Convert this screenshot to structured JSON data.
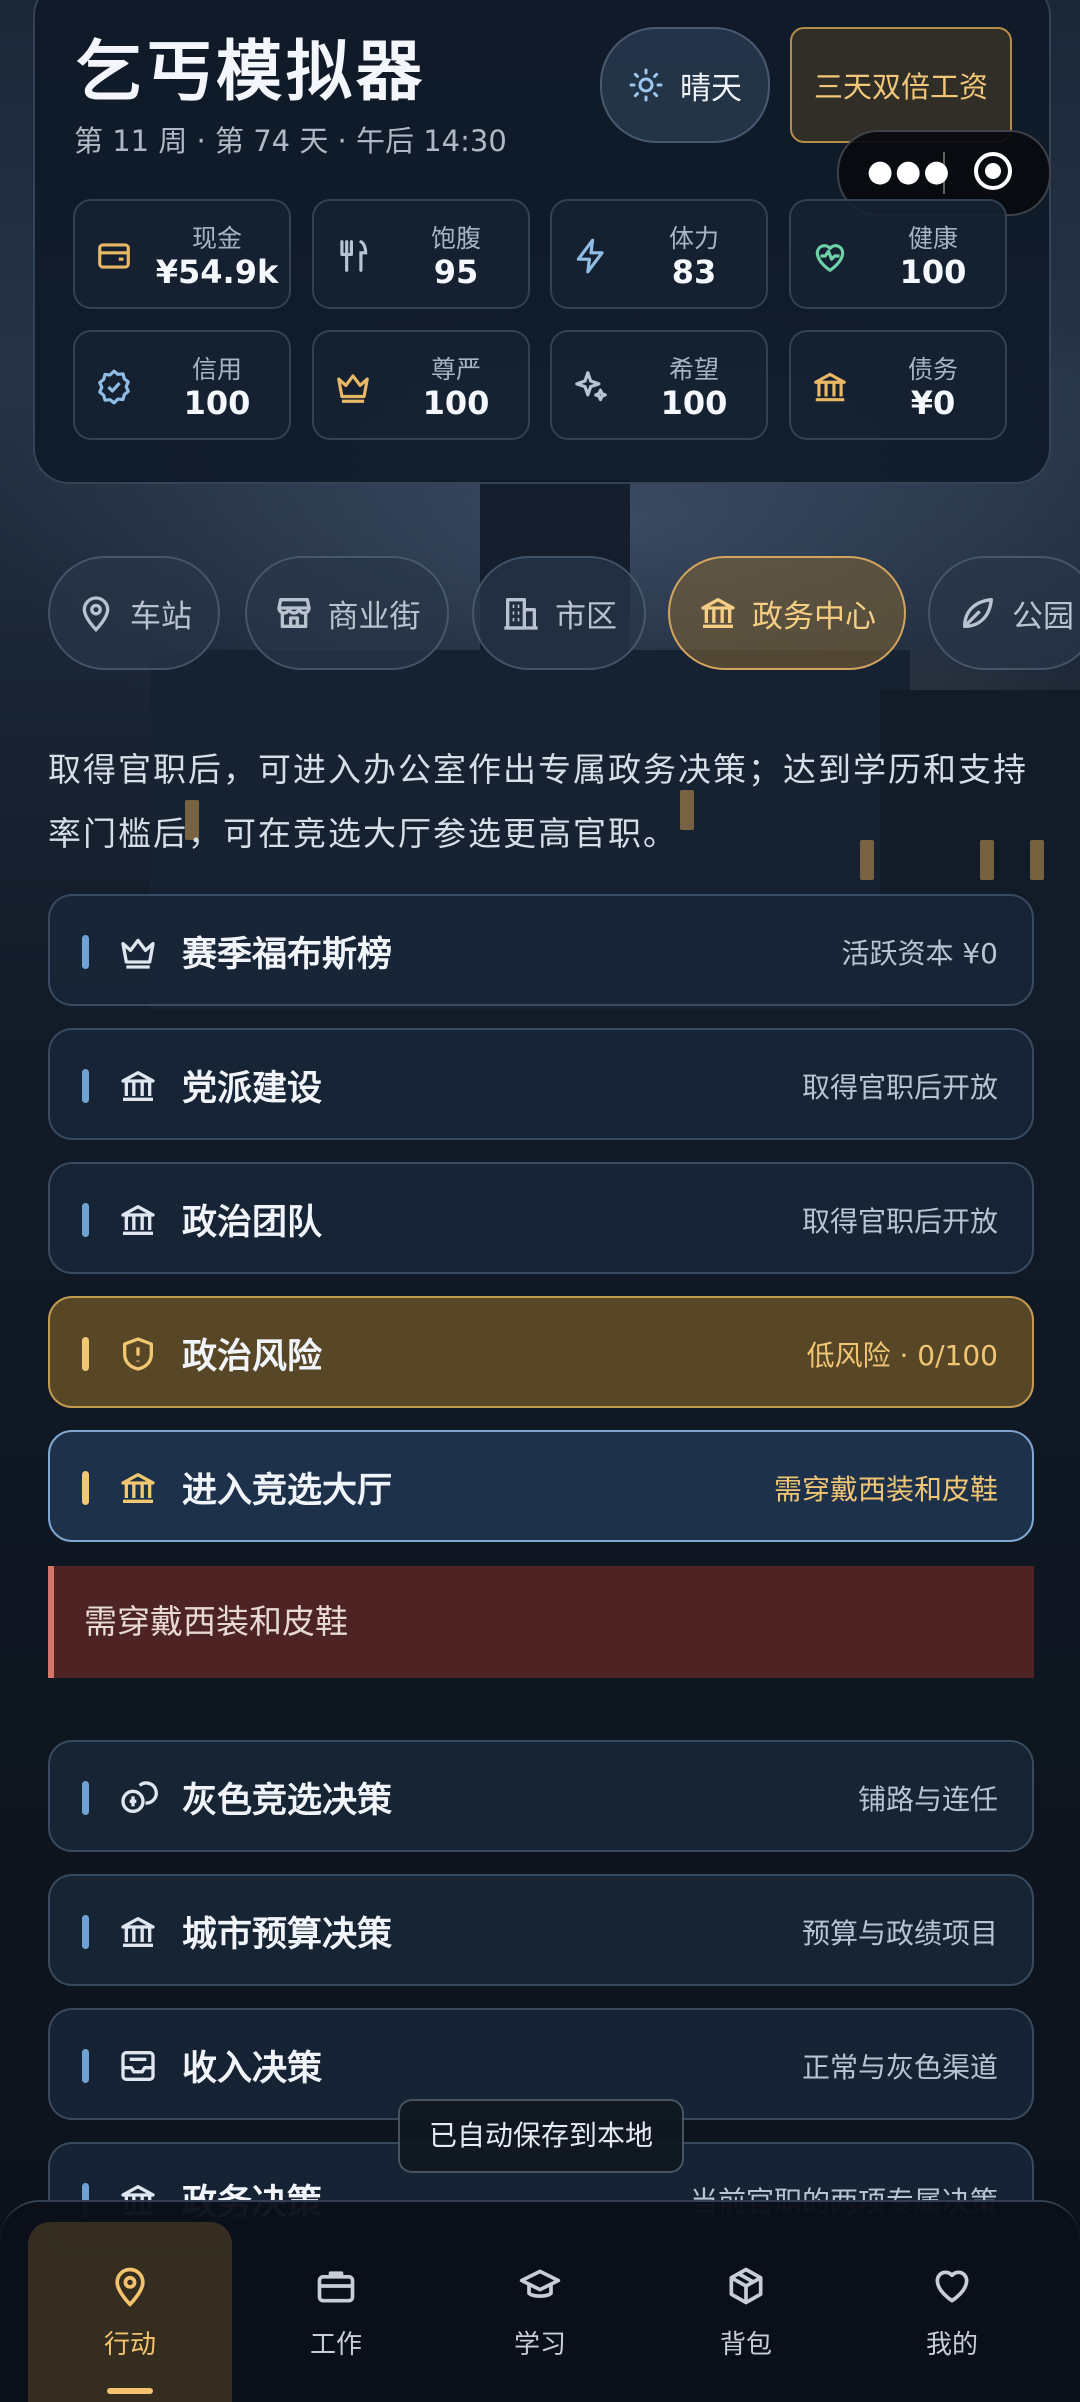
{
  "app": {
    "title": "乞丐模拟器",
    "subtitle": "第 11 周 · 第 74 天 · 午后 14:30",
    "weather": "晴天",
    "promo": "三天双倍工资"
  },
  "stats": [
    {
      "label": "现金",
      "value": "¥54.9k",
      "icon": "wallet-icon"
    },
    {
      "label": "饱腹",
      "value": "95",
      "icon": "utensils-icon"
    },
    {
      "label": "体力",
      "value": "83",
      "icon": "lightning-icon"
    },
    {
      "label": "健康",
      "value": "100",
      "icon": "heart-pulse-icon"
    },
    {
      "label": "信用",
      "value": "100",
      "icon": "badge-check-icon"
    },
    {
      "label": "尊严",
      "value": "100",
      "icon": "crown-icon"
    },
    {
      "label": "希望",
      "value": "100",
      "icon": "sparkle-icon"
    },
    {
      "label": "债务",
      "value": "¥0",
      "icon": "bank-icon"
    }
  ],
  "locations": [
    {
      "label": "车站",
      "icon": "pin-icon",
      "active": false
    },
    {
      "label": "商业街",
      "icon": "store-icon",
      "active": false
    },
    {
      "label": "市区",
      "icon": "buildings-icon",
      "active": false
    },
    {
      "label": "政务中心",
      "icon": "government-icon",
      "active": true
    },
    {
      "label": "公园",
      "icon": "leaf-icon",
      "active": false
    }
  ],
  "description": "取得官职后，可进入办公室作出专属政务决策；达到学历和支持率门槛后，可在竞选大厅参选更高官职。",
  "actions": [
    {
      "title": "赛季福布斯榜",
      "status": "活跃资本  ¥0",
      "icon": "crown-icon"
    },
    {
      "title": "党派建设",
      "status": "取得官职后开放",
      "icon": "government-icon"
    },
    {
      "title": "政治团队",
      "status": "取得官职后开放",
      "icon": "government-icon"
    },
    {
      "title": "政治风险",
      "status": "低风险  ·  0/100",
      "icon": "shield-alert-icon"
    },
    {
      "title": "进入竞选大厅",
      "status": "需穿戴西装和皮鞋",
      "icon": "government-icon"
    }
  ],
  "alert": "需穿戴西装和皮鞋",
  "decisions": [
    {
      "title": "灰色竞选决策",
      "status": "铺路与连任",
      "icon": "coins-icon"
    },
    {
      "title": "城市预算决策",
      "status": "预算与政绩项目",
      "icon": "government-icon"
    },
    {
      "title": "收入决策",
      "status": "正常与灰色渠道",
      "icon": "inbox-icon"
    },
    {
      "title": "政务决策",
      "status": "当前官职的两项专属决策",
      "icon": "government-icon"
    }
  ],
  "toast": "已自动保存到本地",
  "nav": [
    {
      "label": "行动",
      "icon": "map-pin-icon",
      "active": true
    },
    {
      "label": "工作",
      "icon": "briefcase-icon",
      "active": false
    },
    {
      "label": "学习",
      "icon": "graduation-cap-icon",
      "active": false
    },
    {
      "label": "背包",
      "icon": "package-icon",
      "active": false
    },
    {
      "label": "我的",
      "icon": "heart-icon",
      "active": false
    }
  ],
  "colors": {
    "accent_gold": "#f4c36e",
    "accent_blue": "#6fa3d6",
    "alert_red": "#5c2624",
    "panel": "#0e1826"
  }
}
